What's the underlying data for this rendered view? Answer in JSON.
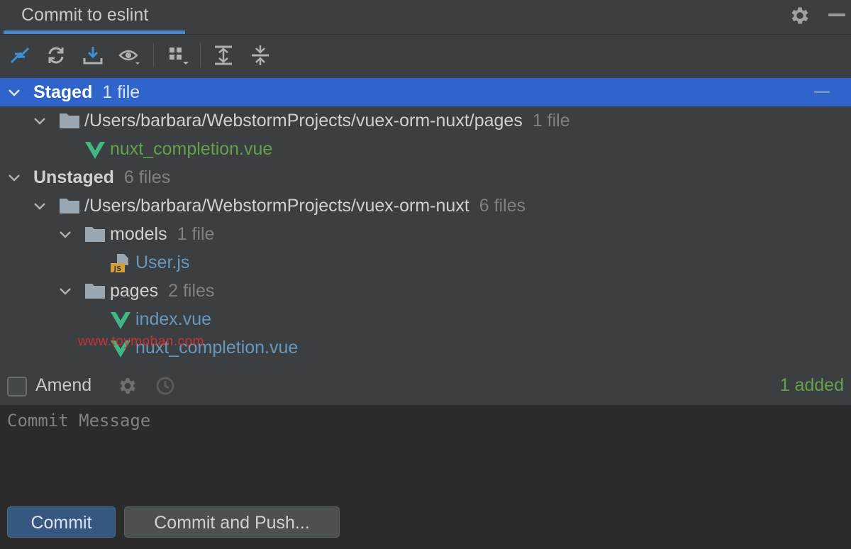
{
  "header": {
    "title": "Commit to eslint",
    "gear_icon": "gear-icon",
    "minimize_icon": "minimize-icon"
  },
  "toolbar": {
    "icons": [
      "diff-arrows-icon",
      "refresh-icon",
      "download-icon",
      "eye-dropdown-icon",
      "group-by-icon",
      "expand-all-icon",
      "collapse-all-icon"
    ]
  },
  "tree": {
    "staged": {
      "label": "Staged",
      "count": "1 file",
      "folder": {
        "path": "/Users/barbara/WebstormProjects/vuex-orm-nuxt/pages",
        "count": "1 file"
      },
      "file": {
        "name": "nuxt_completion.vue"
      }
    },
    "unstaged": {
      "label": "Unstaged",
      "count": "6 files",
      "folder": {
        "path": "/Users/barbara/WebstormProjects/vuex-orm-nuxt",
        "count": "6 files"
      },
      "models": {
        "name": "models",
        "count": "1 file",
        "file": "User.js"
      },
      "pages": {
        "name": "pages",
        "count": "2 files",
        "files": [
          "index.vue",
          "nuxt_completion.vue"
        ]
      }
    }
  },
  "watermark": "www.toymoban.com",
  "amend": {
    "label": "Amend",
    "checked": false,
    "status": "1 added"
  },
  "commit": {
    "placeholder": "Commit Message",
    "commit_label": "Commit",
    "push_label": "Commit and Push..."
  },
  "colors": {
    "selection": "#2f65ca",
    "added_green": "#62a04a",
    "modified_blue": "#6897bb",
    "vue_green": "#41b883",
    "accent": "#4a88c7"
  }
}
